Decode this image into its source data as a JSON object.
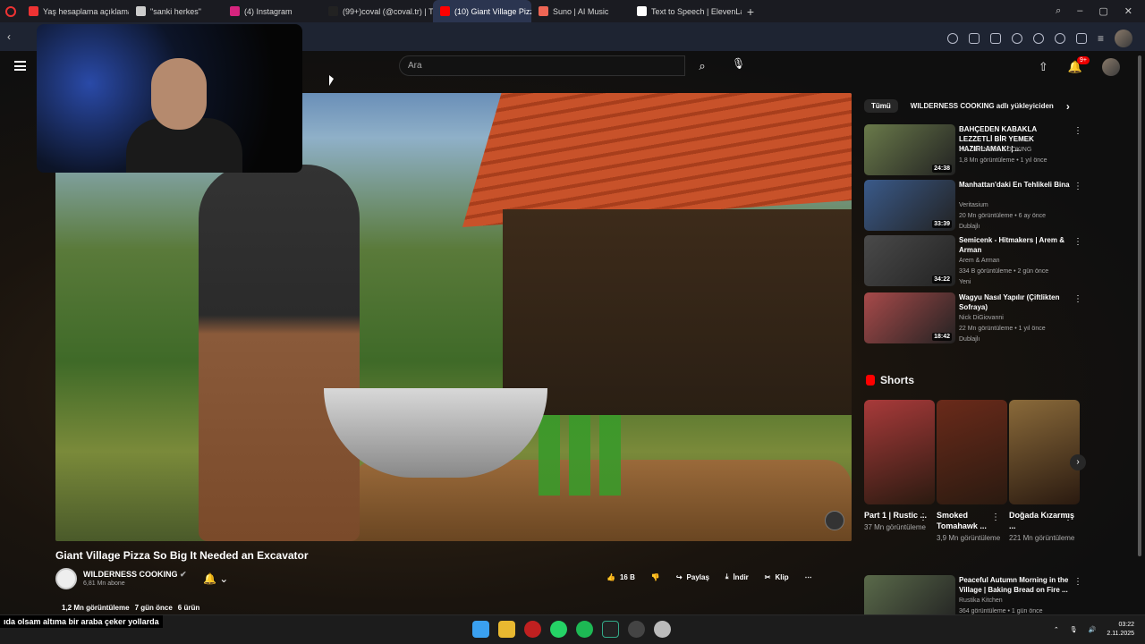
{
  "browser": {
    "tabs": [
      {
        "label": "Yaş hesaplama açıklaması",
        "color": "#e33"
      },
      {
        "label": "\"sanki herkes\"",
        "color": "#ccc"
      },
      {
        "label": "(4) Instagram",
        "color": "#d6247e"
      },
      {
        "label": "(99+)coval (@coval.tr) | Ti",
        "color": "#222"
      },
      {
        "label": "(10) Giant Village Pizz",
        "color": "#f00"
      },
      {
        "label": "Suno | AI Music",
        "color": "#e65"
      },
      {
        "label": "Text to Speech | ElevenLab",
        "color": "#fff"
      }
    ],
    "new_tab": "+"
  },
  "youtube": {
    "search_placeholder": "Ara",
    "notification_count": "9+",
    "video": {
      "title": "Giant Village Pizza So Big It Needed an Excavator",
      "channel": "WILDERNESS COOKING",
      "subscribers": "6,81 Mn abone",
      "likes": "16 B",
      "share": "Paylaş",
      "download": "İndir",
      "clip": "Klip",
      "views": "1,2 Mn görüntüleme",
      "age": "7 gün önce",
      "products": "6 ürün"
    },
    "filters": [
      "Tümü",
      "WILDERNESS COOKING adlı yükleyiciden"
    ],
    "recommendations": [
      {
        "title": "BAHÇEDEN KABAKLA LEZZETLİ BİR YEMEK HAZIRLAMAK! | ...",
        "channel": "WILDERNESS COOKING",
        "meta": "1,8 Mn görüntüleme • 1 yıl önce",
        "badge": "",
        "duration": "24:38",
        "color": "#6a7a4a"
      },
      {
        "title": "Manhattan'daki En Tehlikeli Bina",
        "channel": "Veritasium",
        "meta": "20 Mn görüntüleme • 6 ay önce",
        "badge": "Dublajlı",
        "duration": "33:39",
        "color": "#3a5a8a"
      },
      {
        "title": "Semicenk - Hitmakers | Arem & Arman",
        "channel": "Arem & Arman",
        "meta": "334 B görüntüleme • 2 gün önce",
        "badge": "Yeni",
        "duration": "34:22",
        "color": "#4a4a4a"
      },
      {
        "title": "Wagyu Nasıl Yapılır (Çiftlikten Sofraya)",
        "channel": "Nick DiGiovanni",
        "meta": "22 Mn görüntüleme • 1 yıl önce",
        "badge": "Dublajlı",
        "duration": "18:42",
        "color": "#a84a4a"
      },
      {
        "title": "Peaceful Autumn Morning in the Village | Baking Bread on Fire ...",
        "channel": "Rustika Kitchen",
        "meta": "364 görüntüleme • 1 gün önce",
        "badge": "",
        "duration": "",
        "color": "#5a6a4a"
      }
    ],
    "shorts_label": "Shorts",
    "shorts": [
      {
        "title": "Part 1 | Rustic ...",
        "views": "37 Mn görüntüleme",
        "color": "#a83a3a"
      },
      {
        "title": "Smoked Tomahawk ...",
        "views": "3,9 Mn görüntüleme",
        "color": "#6a2a1a"
      },
      {
        "title": "Doğada Kızarmış ...",
        "views": "221 Mn görüntüleme",
        "color": "#8a6a3a"
      }
    ]
  },
  "overlay": {
    "subtitle": "ıda olsam altıma bir araba çeker yollarda"
  },
  "taskbar": {
    "time": "03:22",
    "date": "2.11.2025"
  }
}
